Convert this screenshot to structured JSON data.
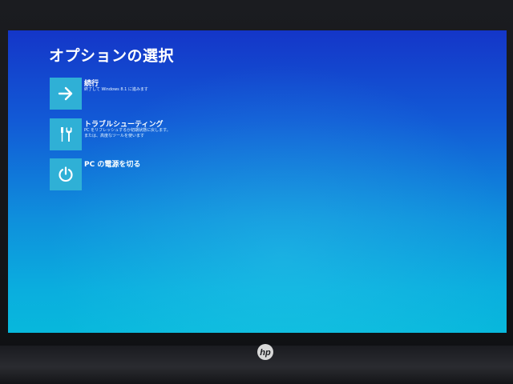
{
  "screen": {
    "title": "オプションの選択",
    "background_colors": [
      "#1436c8",
      "#0f8fdc",
      "#08b8dc"
    ],
    "tile_color": "#2fb0d6"
  },
  "options": [
    {
      "title": "続行",
      "description": "終了して Windows 8.1 に進みます",
      "icon": "arrow-right-icon"
    },
    {
      "title": "トラブルシューティング",
      "description": "PC をリフレッシュするか初期状態に戻します。または、高度なツールを使います",
      "icon": "tools-icon"
    },
    {
      "title": "PC の電源を切る",
      "description": "",
      "icon": "power-icon"
    }
  ],
  "bezel": {
    "logo": "hp"
  }
}
